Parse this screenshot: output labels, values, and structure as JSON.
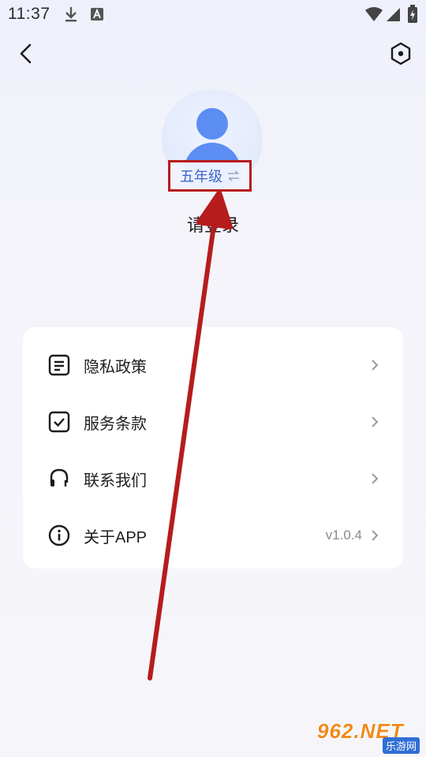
{
  "status_bar": {
    "time": "11:37",
    "icons": [
      "download-icon",
      "accessibility-a-icon",
      "wifi-icon",
      "signal-icon",
      "battery-icon"
    ]
  },
  "nav": {
    "back_icon": "chevron-left-icon",
    "settings_icon": "hexagon-settings-icon"
  },
  "profile": {
    "grade_label": "五年级",
    "swap_icon": "swap-arrows-icon",
    "login_prompt": "请登录"
  },
  "menu": {
    "items": [
      {
        "label": "隐私政策",
        "icon": "document-icon",
        "value": ""
      },
      {
        "label": "服务条款",
        "icon": "checkbox-icon",
        "value": ""
      },
      {
        "label": "联系我们",
        "icon": "headset-icon",
        "value": ""
      },
      {
        "label": "关于APP",
        "icon": "info-icon",
        "value": "v1.0.4"
      }
    ]
  },
  "watermark": {
    "main": "962.NET",
    "sub": "乐游网"
  },
  "colors": {
    "accent_blue": "#5b8df3",
    "grade_text": "#3e66c9",
    "annotation_red": "#b71c1c",
    "card_bg": "#ffffff"
  }
}
